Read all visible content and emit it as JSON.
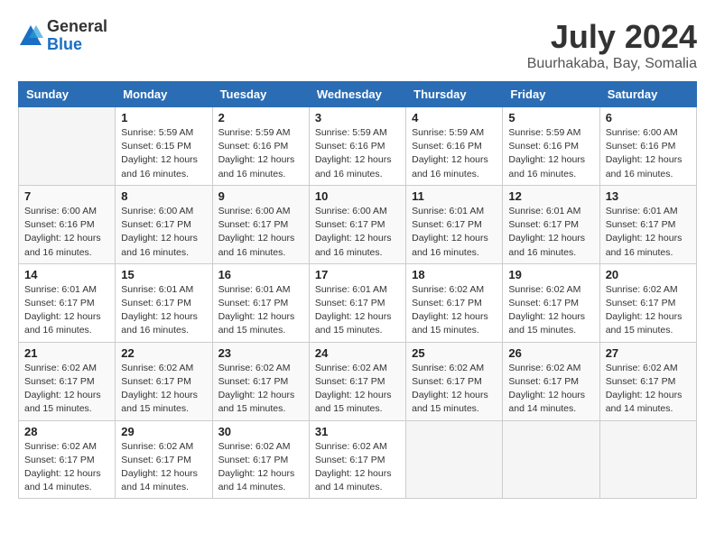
{
  "header": {
    "logo_general": "General",
    "logo_blue": "Blue",
    "month_title": "July 2024",
    "location": "Buurhakaba, Bay, Somalia"
  },
  "weekdays": [
    "Sunday",
    "Monday",
    "Tuesday",
    "Wednesday",
    "Thursday",
    "Friday",
    "Saturday"
  ],
  "weeks": [
    [
      {
        "day": null,
        "sunrise": null,
        "sunset": null,
        "daylight": null
      },
      {
        "day": "1",
        "sunrise": "Sunrise: 5:59 AM",
        "sunset": "Sunset: 6:15 PM",
        "daylight": "Daylight: 12 hours and 16 minutes."
      },
      {
        "day": "2",
        "sunrise": "Sunrise: 5:59 AM",
        "sunset": "Sunset: 6:16 PM",
        "daylight": "Daylight: 12 hours and 16 minutes."
      },
      {
        "day": "3",
        "sunrise": "Sunrise: 5:59 AM",
        "sunset": "Sunset: 6:16 PM",
        "daylight": "Daylight: 12 hours and 16 minutes."
      },
      {
        "day": "4",
        "sunrise": "Sunrise: 5:59 AM",
        "sunset": "Sunset: 6:16 PM",
        "daylight": "Daylight: 12 hours and 16 minutes."
      },
      {
        "day": "5",
        "sunrise": "Sunrise: 5:59 AM",
        "sunset": "Sunset: 6:16 PM",
        "daylight": "Daylight: 12 hours and 16 minutes."
      },
      {
        "day": "6",
        "sunrise": "Sunrise: 6:00 AM",
        "sunset": "Sunset: 6:16 PM",
        "daylight": "Daylight: 12 hours and 16 minutes."
      }
    ],
    [
      {
        "day": "7",
        "sunrise": "Sunrise: 6:00 AM",
        "sunset": "Sunset: 6:16 PM",
        "daylight": "Daylight: 12 hours and 16 minutes."
      },
      {
        "day": "8",
        "sunrise": "Sunrise: 6:00 AM",
        "sunset": "Sunset: 6:17 PM",
        "daylight": "Daylight: 12 hours and 16 minutes."
      },
      {
        "day": "9",
        "sunrise": "Sunrise: 6:00 AM",
        "sunset": "Sunset: 6:17 PM",
        "daylight": "Daylight: 12 hours and 16 minutes."
      },
      {
        "day": "10",
        "sunrise": "Sunrise: 6:00 AM",
        "sunset": "Sunset: 6:17 PM",
        "daylight": "Daylight: 12 hours and 16 minutes."
      },
      {
        "day": "11",
        "sunrise": "Sunrise: 6:01 AM",
        "sunset": "Sunset: 6:17 PM",
        "daylight": "Daylight: 12 hours and 16 minutes."
      },
      {
        "day": "12",
        "sunrise": "Sunrise: 6:01 AM",
        "sunset": "Sunset: 6:17 PM",
        "daylight": "Daylight: 12 hours and 16 minutes."
      },
      {
        "day": "13",
        "sunrise": "Sunrise: 6:01 AM",
        "sunset": "Sunset: 6:17 PM",
        "daylight": "Daylight: 12 hours and 16 minutes."
      }
    ],
    [
      {
        "day": "14",
        "sunrise": "Sunrise: 6:01 AM",
        "sunset": "Sunset: 6:17 PM",
        "daylight": "Daylight: 12 hours and 16 minutes."
      },
      {
        "day": "15",
        "sunrise": "Sunrise: 6:01 AM",
        "sunset": "Sunset: 6:17 PM",
        "daylight": "Daylight: 12 hours and 16 minutes."
      },
      {
        "day": "16",
        "sunrise": "Sunrise: 6:01 AM",
        "sunset": "Sunset: 6:17 PM",
        "daylight": "Daylight: 12 hours and 15 minutes."
      },
      {
        "day": "17",
        "sunrise": "Sunrise: 6:01 AM",
        "sunset": "Sunset: 6:17 PM",
        "daylight": "Daylight: 12 hours and 15 minutes."
      },
      {
        "day": "18",
        "sunrise": "Sunrise: 6:02 AM",
        "sunset": "Sunset: 6:17 PM",
        "daylight": "Daylight: 12 hours and 15 minutes."
      },
      {
        "day": "19",
        "sunrise": "Sunrise: 6:02 AM",
        "sunset": "Sunset: 6:17 PM",
        "daylight": "Daylight: 12 hours and 15 minutes."
      },
      {
        "day": "20",
        "sunrise": "Sunrise: 6:02 AM",
        "sunset": "Sunset: 6:17 PM",
        "daylight": "Daylight: 12 hours and 15 minutes."
      }
    ],
    [
      {
        "day": "21",
        "sunrise": "Sunrise: 6:02 AM",
        "sunset": "Sunset: 6:17 PM",
        "daylight": "Daylight: 12 hours and 15 minutes."
      },
      {
        "day": "22",
        "sunrise": "Sunrise: 6:02 AM",
        "sunset": "Sunset: 6:17 PM",
        "daylight": "Daylight: 12 hours and 15 minutes."
      },
      {
        "day": "23",
        "sunrise": "Sunrise: 6:02 AM",
        "sunset": "Sunset: 6:17 PM",
        "daylight": "Daylight: 12 hours and 15 minutes."
      },
      {
        "day": "24",
        "sunrise": "Sunrise: 6:02 AM",
        "sunset": "Sunset: 6:17 PM",
        "daylight": "Daylight: 12 hours and 15 minutes."
      },
      {
        "day": "25",
        "sunrise": "Sunrise: 6:02 AM",
        "sunset": "Sunset: 6:17 PM",
        "daylight": "Daylight: 12 hours and 15 minutes."
      },
      {
        "day": "26",
        "sunrise": "Sunrise: 6:02 AM",
        "sunset": "Sunset: 6:17 PM",
        "daylight": "Daylight: 12 hours and 14 minutes."
      },
      {
        "day": "27",
        "sunrise": "Sunrise: 6:02 AM",
        "sunset": "Sunset: 6:17 PM",
        "daylight": "Daylight: 12 hours and 14 minutes."
      }
    ],
    [
      {
        "day": "28",
        "sunrise": "Sunrise: 6:02 AM",
        "sunset": "Sunset: 6:17 PM",
        "daylight": "Daylight: 12 hours and 14 minutes."
      },
      {
        "day": "29",
        "sunrise": "Sunrise: 6:02 AM",
        "sunset": "Sunset: 6:17 PM",
        "daylight": "Daylight: 12 hours and 14 minutes."
      },
      {
        "day": "30",
        "sunrise": "Sunrise: 6:02 AM",
        "sunset": "Sunset: 6:17 PM",
        "daylight": "Daylight: 12 hours and 14 minutes."
      },
      {
        "day": "31",
        "sunrise": "Sunrise: 6:02 AM",
        "sunset": "Sunset: 6:17 PM",
        "daylight": "Daylight: 12 hours and 14 minutes."
      },
      {
        "day": null,
        "sunrise": null,
        "sunset": null,
        "daylight": null
      },
      {
        "day": null,
        "sunrise": null,
        "sunset": null,
        "daylight": null
      },
      {
        "day": null,
        "sunrise": null,
        "sunset": null,
        "daylight": null
      }
    ]
  ]
}
